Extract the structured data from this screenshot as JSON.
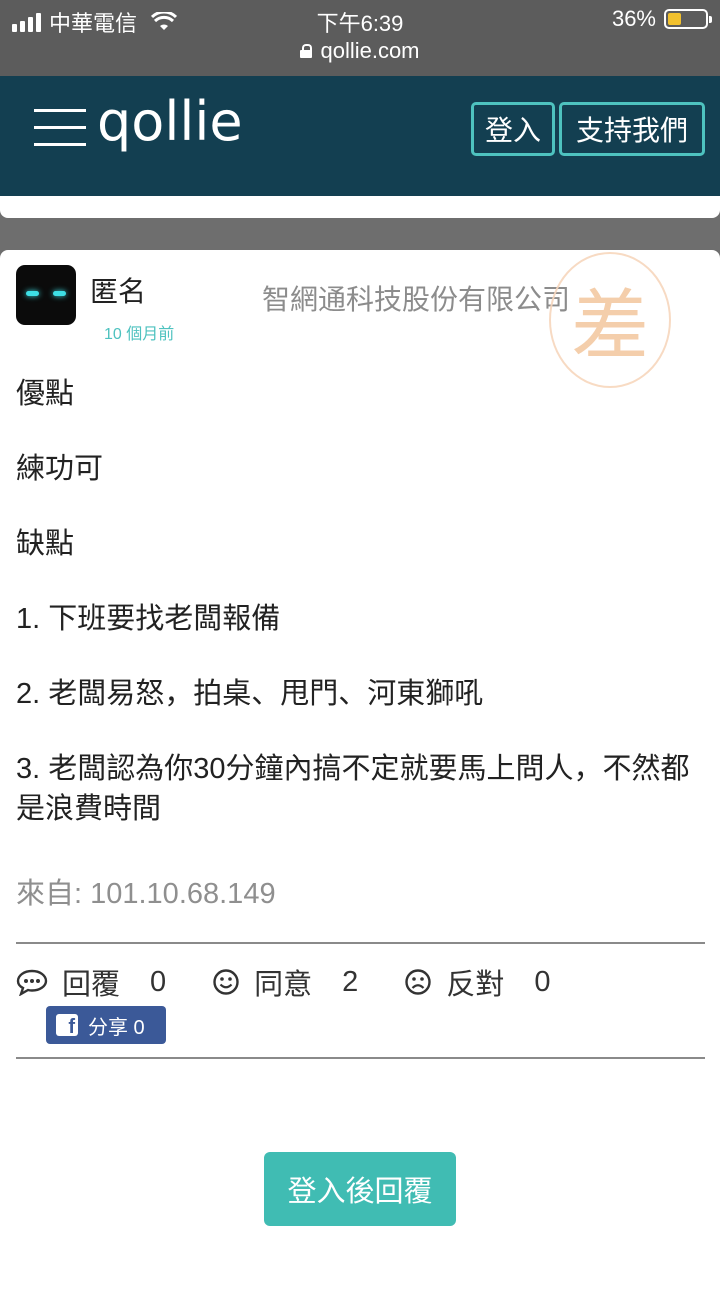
{
  "status_bar": {
    "carrier": "中華電信",
    "time": "下午6:39",
    "battery_percent": "36%",
    "battery_level": 0.36,
    "url": "qollie.com"
  },
  "header": {
    "logo": "qollie",
    "login_label": "登入",
    "support_label": "支持我們",
    "background": "#133f51",
    "accent": "#4ec2bf"
  },
  "post": {
    "author": "匿名",
    "time_ago": "10 個月前",
    "company": "智網通科技股份有限公司",
    "stamp_char": "差",
    "paragraphs": [
      "優點",
      "練功可",
      "缺點",
      "1. 下班要找老闆報備",
      "2. 老闆易怒，拍桌、甩門、河東獅吼",
      "3. 老闆認為你30分鐘內搞不定就要馬上問人，不然都是浪費時間"
    ],
    "source": "來自: 101.10.68.149",
    "reply_label": "回覆",
    "reply_count": "0",
    "agree_label": "同意",
    "agree_count": "2",
    "disagree_label": "反對",
    "disagree_count": "0",
    "share_label": "分享 0"
  },
  "reply_after_login": "登入後回覆",
  "icons": {
    "menu": "hamburger-menu-icon",
    "comment": "speech-bubble-icon",
    "agree": "smile-icon",
    "disagree": "frown-icon",
    "facebook": "facebook-icon",
    "lock": "lock-icon"
  }
}
